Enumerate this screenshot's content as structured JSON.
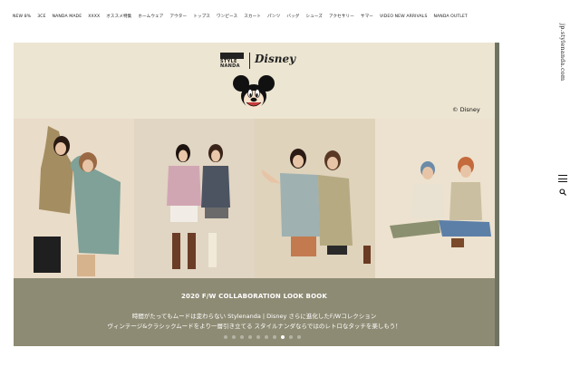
{
  "nav": {
    "items": [
      "NEW 8%",
      "3CE",
      "NANDA MADE",
      "XXXX",
      "オススメ特集",
      "ホームウェア",
      "アウター",
      "トップス",
      "ワンピース",
      "スカート",
      "パンツ",
      "バッグ",
      "シューズ",
      "アクセサリー",
      "サマー",
      "VIDEO NEW ARRIVALS",
      "NANDA OUTLET"
    ]
  },
  "site": {
    "url": "jp.stylenanda.com"
  },
  "slide": {
    "brand_top": "STYLE",
    "brand_bottom": "NANDA",
    "collab_brand": "Disney",
    "copyright": "© Disney",
    "title": "2020 F/W COLLABORATION LOOK BOOK",
    "line1": "時間がたってもムードは変わらない Stylenanda | Disney さらに進化したF/Wコレクション",
    "line2": "ヴィンテージ&クラシックムードをより一層引き立てる スタイルナンダならではのレトロなタッチを楽しもう！"
  },
  "slider": {
    "dot_count": 10,
    "active_index": 7
  },
  "colors": {
    "banner_bg": "#ece5d2",
    "caption_bg": "#8e8b74",
    "accent_text": "#ffffff"
  }
}
